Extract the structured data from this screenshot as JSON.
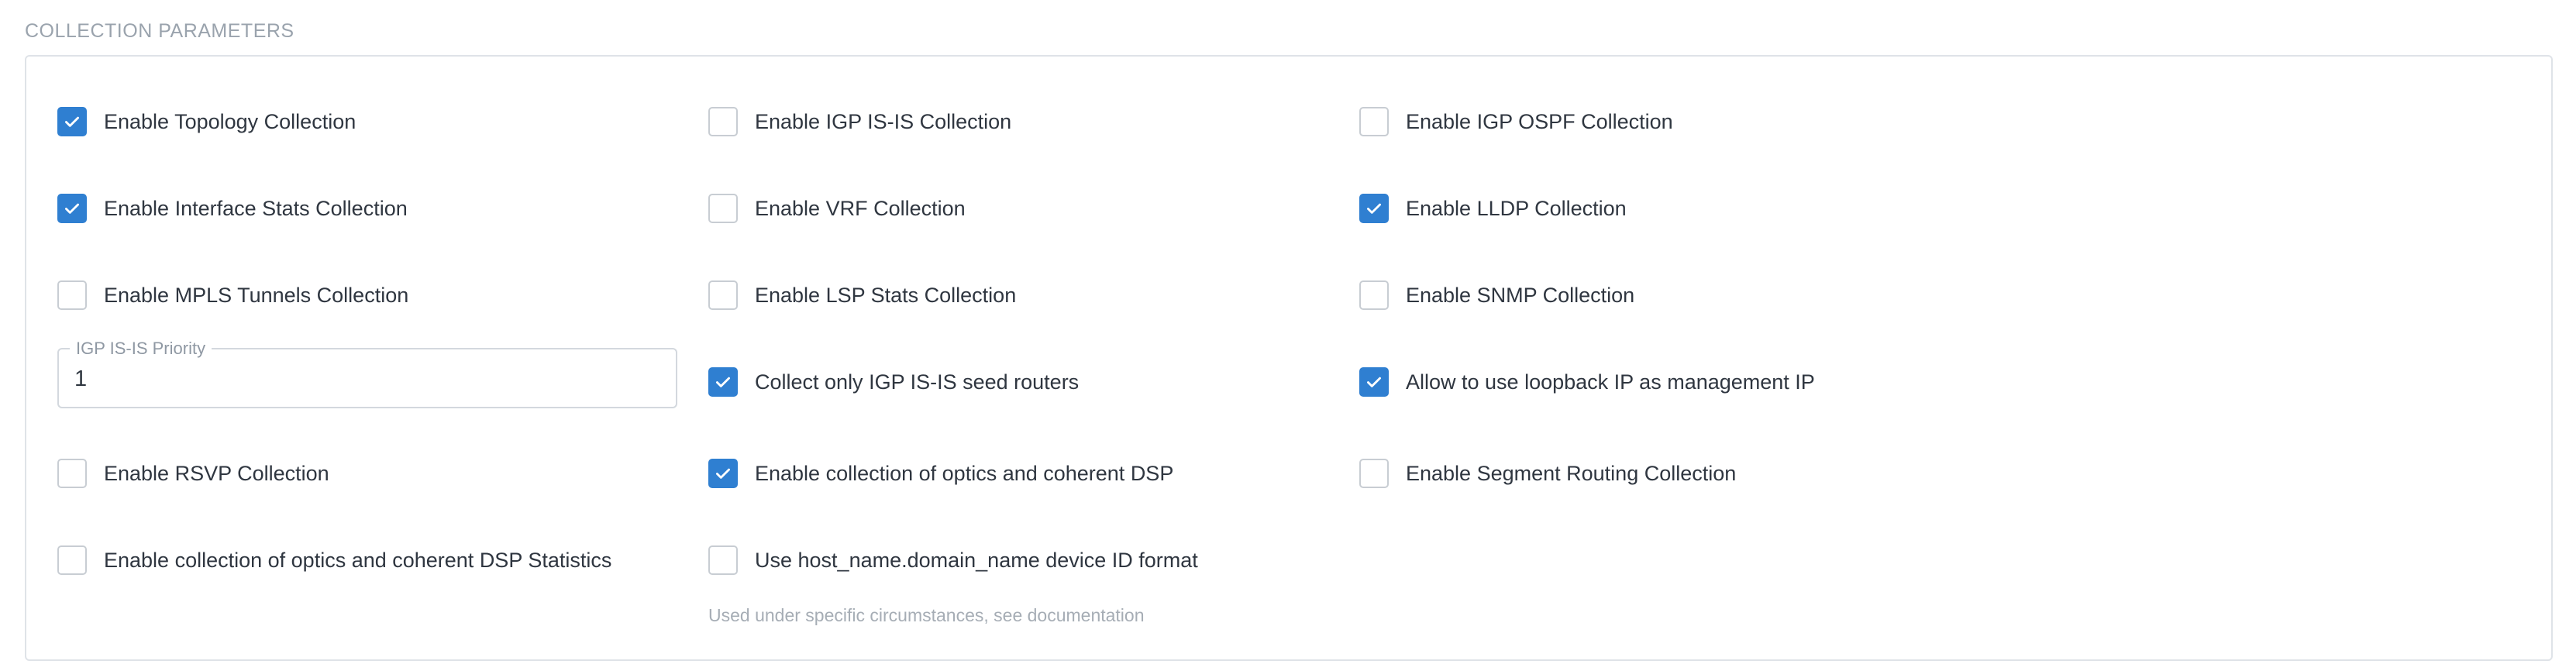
{
  "section": {
    "title": "COLLECTION PARAMETERS"
  },
  "colors": {
    "checked": "#2f7fd1",
    "border": "#c8cdd3",
    "muted": "#9aa3ad"
  },
  "options": {
    "topology": {
      "label": "Enable Topology Collection",
      "checked": true
    },
    "igp_isis": {
      "label": "Enable IGP IS-IS Collection",
      "checked": false
    },
    "igp_ospf": {
      "label": "Enable IGP OSPF Collection",
      "checked": false
    },
    "interface_stats": {
      "label": "Enable Interface Stats Collection",
      "checked": true
    },
    "vrf": {
      "label": "Enable VRF Collection",
      "checked": false
    },
    "lldp": {
      "label": "Enable LLDP Collection",
      "checked": true
    },
    "mpls_tunnels": {
      "label": "Enable MPLS Tunnels Collection",
      "checked": false
    },
    "lsp_stats": {
      "label": "Enable LSP Stats Collection",
      "checked": false
    },
    "snmp": {
      "label": "Enable SNMP Collection",
      "checked": false
    },
    "seed_routers": {
      "label": "Collect only IGP IS-IS seed routers",
      "checked": true
    },
    "loopback_mgmt": {
      "label": "Allow to use loopback IP as management IP",
      "checked": true
    },
    "rsvp": {
      "label": "Enable RSVP Collection",
      "checked": false
    },
    "optics_dsp": {
      "label": "Enable collection of optics and coherent DSP",
      "checked": true
    },
    "segment_routing": {
      "label": "Enable Segment Routing Collection",
      "checked": false
    },
    "optics_dsp_stats": {
      "label": "Enable collection of optics and coherent DSP Statistics",
      "checked": false
    },
    "hostname_format": {
      "label": "Use host_name.domain_name device ID format",
      "checked": false
    }
  },
  "priority_field": {
    "label": "IGP IS-IS Priority",
    "value": "1"
  },
  "helper_text": "Used under specific circumstances, see documentation"
}
